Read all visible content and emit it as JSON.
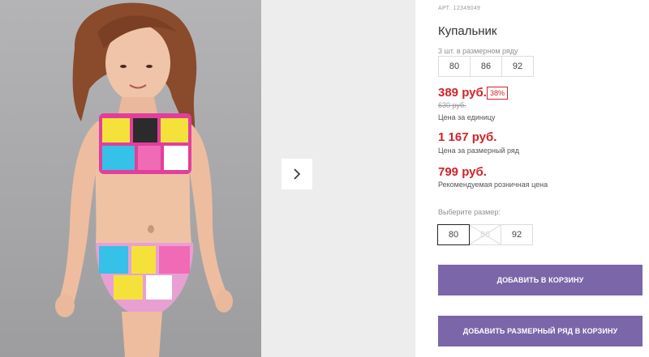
{
  "product": {
    "article_label": "АРТ.",
    "article_number": "12349049",
    "title": "Купальник"
  },
  "size_range": {
    "note": "3 шт. в размерном ряду",
    "sizes": [
      "80",
      "86",
      "92"
    ]
  },
  "pricing": {
    "unit_price": "389 руб.",
    "discount": "38%",
    "old_price": "630 руб.",
    "unit_caption": "Цена за единицу",
    "range_price": "1 167 руб.",
    "range_caption": "Цена за размерный ряд",
    "retail_price": "799 руб.",
    "retail_caption": "Рекомендуемая розничная цена",
    "accent_color": "#d2232a"
  },
  "size_picker": {
    "label": "Выберите размер:",
    "options": [
      {
        "label": "80",
        "state": "selected"
      },
      {
        "label": "86",
        "state": "disabled"
      },
      {
        "label": "92",
        "state": "available"
      }
    ]
  },
  "actions": {
    "add_to_cart": "ДОБАВИТЬ В КОРЗИНУ",
    "add_range_to_cart": "ДОБАВИТЬ РАЗМЕРНЫЙ РЯД В КОРЗИНУ",
    "button_color": "#7a66a8"
  },
  "gallery": {
    "next_icon": "chevron-right-icon"
  }
}
